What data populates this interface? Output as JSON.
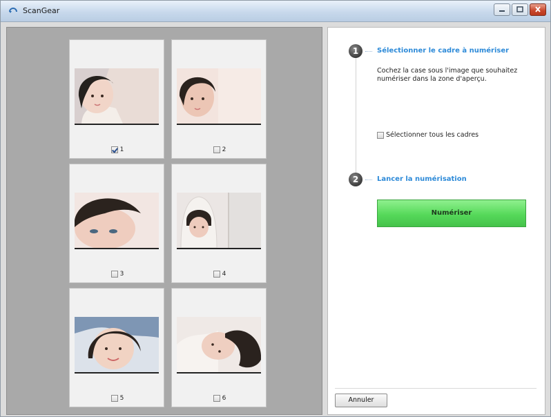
{
  "window": {
    "title": "ScanGear"
  },
  "frames": [
    {
      "label": "1",
      "checked": true
    },
    {
      "label": "2",
      "checked": false
    },
    {
      "label": "3",
      "checked": false
    },
    {
      "label": "4",
      "checked": false
    },
    {
      "label": "5",
      "checked": false
    },
    {
      "label": "6",
      "checked": false
    }
  ],
  "steps": [
    {
      "number": "1",
      "title": "Sélectionner le cadre à numériser",
      "description": "Cochez la case sous l'image que souhaitez numériser dans la zone d'aperçu."
    },
    {
      "number": "2",
      "title": "Lancer la numérisation"
    }
  ],
  "select_all": {
    "label": "Sélectionner tous les cadres",
    "checked": false
  },
  "actions": {
    "scan_label": "Numériser",
    "cancel_label": "Annuler"
  },
  "colors": {
    "accent": "#2d8ad8",
    "scan_button": "#56d95a"
  },
  "icons": {
    "app": "scangear-icon",
    "minimize": "minimize-icon",
    "maximize": "maximize-icon",
    "close": "close-icon"
  }
}
